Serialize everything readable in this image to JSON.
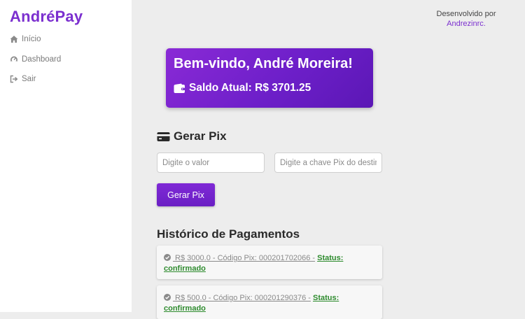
{
  "sidebar": {
    "brand": "AndréPay",
    "items": [
      {
        "label": "Início",
        "icon": "home-icon"
      },
      {
        "label": "Dashboard",
        "icon": "dashboard-icon"
      },
      {
        "label": "Sair",
        "icon": "sign-out-icon"
      }
    ]
  },
  "credit": {
    "text": "Desenvolvido por",
    "author": "Andrezinrc."
  },
  "welcome": {
    "greeting": "Bem-vindo, André Moreira!",
    "balance": "Saldo Atual: R$ 3701.25",
    "balance_icon": "wallet-icon"
  },
  "pix": {
    "title": "Gerar Pix",
    "title_icon": "credit-card-icon",
    "value_placeholder": "Digite o valor",
    "key_placeholder": "Digite a chave Pix do destinatário",
    "button_label": "Gerar Pix"
  },
  "history": {
    "title": "Histórico de Pagamentos",
    "status_label": "Status:",
    "items": [
      {
        "text": " R$ 3000.0 - Código Pix: 000201702066 -",
        "status": "confirmado"
      },
      {
        "text": " R$ 500.0 - Código Pix: 000201290376 -",
        "status": "confirmado"
      }
    ]
  },
  "colors": {
    "accent": "#7b2fcf",
    "status_green": "#2e8b2e",
    "background": "#ededed"
  }
}
